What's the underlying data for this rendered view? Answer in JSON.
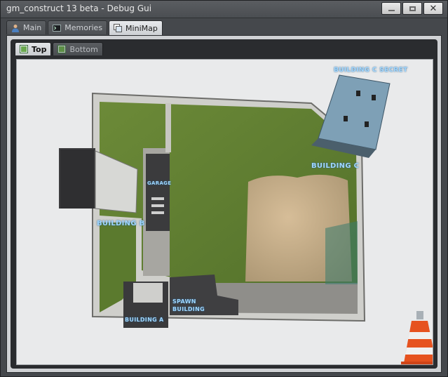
{
  "window": {
    "title": "gm_construct 13 beta - Debug Gui",
    "buttons": [
      "minimize-icon",
      "maximize-icon",
      "close-icon"
    ],
    "close_glyph": "✕"
  },
  "tabs": [
    {
      "label": "Main",
      "icon": "user-icon",
      "active": false
    },
    {
      "label": "Memories",
      "icon": "terminal-icon",
      "active": false
    },
    {
      "label": "MiniMap",
      "icon": "map-icon",
      "active": true
    }
  ],
  "subtabs": [
    {
      "label": "Top",
      "icon": "image-icon",
      "active": true
    },
    {
      "label": "Bottom",
      "icon": "image-icon",
      "active": false
    }
  ],
  "map": {
    "labels": {
      "building_c_secret": "BUILDING C SECRET",
      "building_c": "BUILDING C",
      "garage": "GARAGE",
      "building_b": "BUILDING B",
      "spawn_building_line1": "SPAWN",
      "spawn_building_line2": "BUILDING",
      "building_a": "BUILDING A"
    },
    "marker_icon": "traffic-cone-icon",
    "colors": {
      "grass": "#5e7a2e",
      "sand": "#cbb089",
      "concrete": "#9a9a98",
      "label": "#9fd6ff"
    }
  }
}
